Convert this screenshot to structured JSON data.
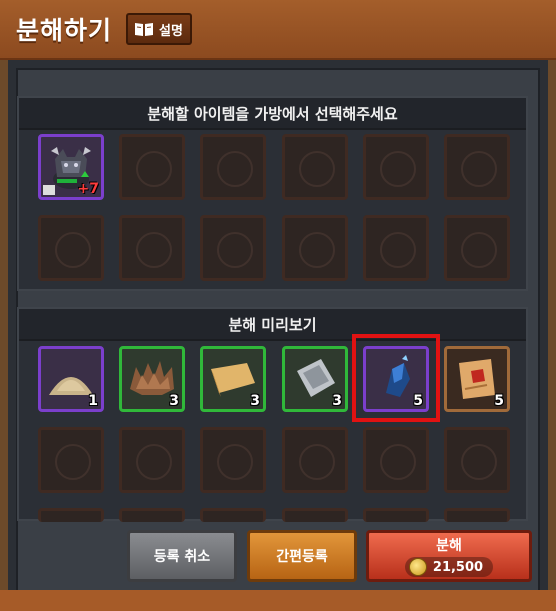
{
  "header": {
    "title": "분해하기",
    "help_label": "설명"
  },
  "register_panel": {
    "title": "분해할 아이템을 가방에서 선택해주세요",
    "items": [
      {
        "slot": 1,
        "name": "monster-armor-item",
        "enhance": "+7",
        "rarity": "purple"
      }
    ]
  },
  "preview_panel": {
    "title": "분해 미리보기",
    "items": [
      {
        "name": "sand-pile",
        "rarity": "purple",
        "qty": "1"
      },
      {
        "name": "brown-fur",
        "rarity": "green",
        "qty": "3"
      },
      {
        "name": "leather-sheet",
        "rarity": "green",
        "qty": "3"
      },
      {
        "name": "metal-ingot-mold",
        "rarity": "green",
        "qty": "3"
      },
      {
        "name": "blue-crystal-shard",
        "rarity": "purple",
        "qty": "5"
      },
      {
        "name": "scroll-sheet",
        "rarity": "bronze",
        "qty": "5"
      }
    ]
  },
  "buttons": {
    "cancel_label": "등록 취소",
    "simple_register_label": "간편등록",
    "decompose_label": "분해",
    "decompose_cost": "21,500"
  },
  "colors": {
    "header": "#a45e2b",
    "purple_rarity": "#7b3fcc",
    "green_rarity": "#30b83a",
    "bronze_rarity": "#a06a3a",
    "highlight": "#e11212"
  }
}
